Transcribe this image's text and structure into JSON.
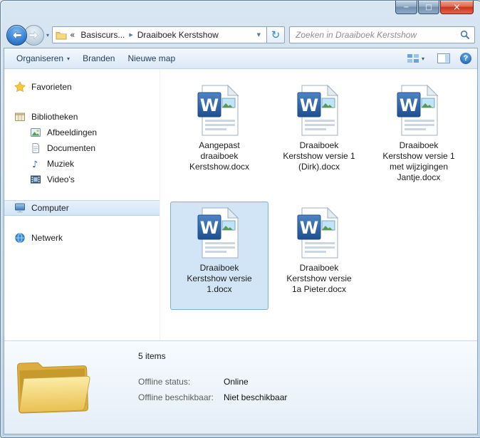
{
  "nav": {
    "breadcrumb": [
      "Basiscurs...",
      "Draaiboek Kerstshow"
    ],
    "search_placeholder": "Zoeken in Draaiboek Kerstshow"
  },
  "toolbar": {
    "items": [
      "Organiseren",
      "Branden",
      "Nieuwe map"
    ]
  },
  "sidebar": {
    "items": [
      {
        "label": "Favorieten"
      },
      {
        "label": "Bibliotheken"
      },
      {
        "label": "Afbeeldingen"
      },
      {
        "label": "Documenten"
      },
      {
        "label": "Muziek"
      },
      {
        "label": "Video's"
      },
      {
        "label": "Computer",
        "selected": true
      },
      {
        "label": "Netwerk"
      }
    ]
  },
  "files": [
    {
      "name": "Aangepast draaiboek Kerstshow.docx"
    },
    {
      "name": "Draaiboek Kerstshow versie 1 (Dirk).docx"
    },
    {
      "name": "Draaiboek Kerstshow versie 1 met wijzigingen Jantje.docx"
    },
    {
      "name": "Draaiboek Kerstshow versie 1.docx",
      "selected": true
    },
    {
      "name": "Draaiboek Kerstshow versie 1a Pieter.docx"
    }
  ],
  "details": {
    "items_count": "5 items",
    "fields": [
      {
        "label": "Offline status:",
        "value": "Online"
      },
      {
        "label": "Offline beschikbaar:",
        "value": "Niet beschikbaar"
      }
    ]
  },
  "icons": {
    "minimize": "−",
    "maximize": "□",
    "close": "×",
    "chevron_down": "▾",
    "overflow": "«",
    "crumb_separator": "▶",
    "crumb_dropdown": "▼",
    "refresh": "↻",
    "help": "?",
    "word_w": "W",
    "music_note": "♪"
  },
  "colors": {
    "selection_fill": "#d2e5f7",
    "selection_border": "#84aed8",
    "close_button_red": "#c8341c",
    "word_blue": "#2a5699",
    "folder_yellow": "#ecc258"
  }
}
